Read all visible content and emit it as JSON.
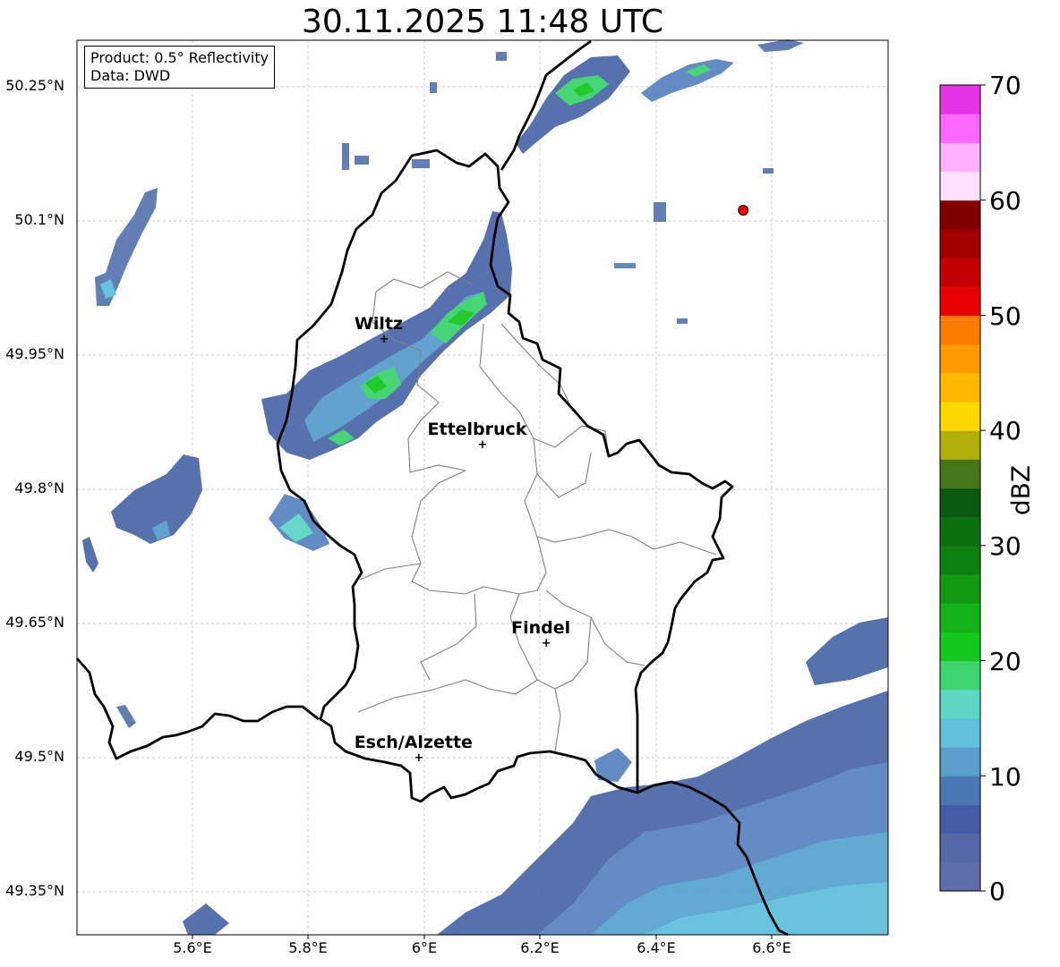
{
  "title": "30.11.2025 11:48 UTC",
  "info_box": {
    "product": "Product: 0.5° Reflectivity",
    "data": "Data: DWD"
  },
  "axes": {
    "lon_ticks": [
      "5.6°E",
      "5.8°E",
      "6°E",
      "6.2°E",
      "6.4°E",
      "6.6°E"
    ],
    "lat_ticks": [
      "50.25°N",
      "50.1°N",
      "49.95°N",
      "49.8°N",
      "49.65°N",
      "49.5°N",
      "49.35°N"
    ],
    "lon_values": [
      5.6,
      5.8,
      6.0,
      6.2,
      6.4,
      6.6
    ],
    "lat_values": [
      50.25,
      50.1,
      49.95,
      49.8,
      49.65,
      49.5,
      49.35
    ],
    "lon_range": [
      5.4,
      6.8
    ],
    "lat_range": [
      49.3,
      50.3
    ]
  },
  "cities": [
    {
      "name": "Wiltz",
      "lon": 5.93,
      "lat": 49.967
    },
    {
      "name": "Ettelbruck",
      "lon": 6.1,
      "lat": 49.849
    },
    {
      "name": "Findel",
      "lon": 6.21,
      "lat": 49.627
    },
    {
      "name": "Esch/Alzette",
      "lon": 5.99,
      "lat": 49.499
    }
  ],
  "radar_site": {
    "lon": 6.55,
    "lat": 50.11,
    "color": "#ee0000"
  },
  "colorbar": {
    "label": "dBZ",
    "ticks": [
      "70",
      "60",
      "50",
      "40",
      "30",
      "20",
      "10",
      "0"
    ],
    "range": [
      0,
      70
    ],
    "colors": [
      "#5e6fa8",
      "#5469a6",
      "#445ca6",
      "#4a78b4",
      "#5a9ecc",
      "#62c0dc",
      "#5ed6c6",
      "#3ed46e",
      "#14c81e",
      "#12b418",
      "#129a12",
      "#0e8010",
      "#0c7010",
      "#0a5a0e",
      "#45761a",
      "#b0b00a",
      "#ffd800",
      "#ffb800",
      "#ff9a00",
      "#ff7c00",
      "#e60000",
      "#c20000",
      "#a00000",
      "#800000",
      "#ffe0ff",
      "#ffb0ff",
      "#ff66ff",
      "#e633e6"
    ]
  },
  "legend_colors": {
    "border": "#000000",
    "canton": "#808080",
    "grid": "#bbbbbb"
  }
}
